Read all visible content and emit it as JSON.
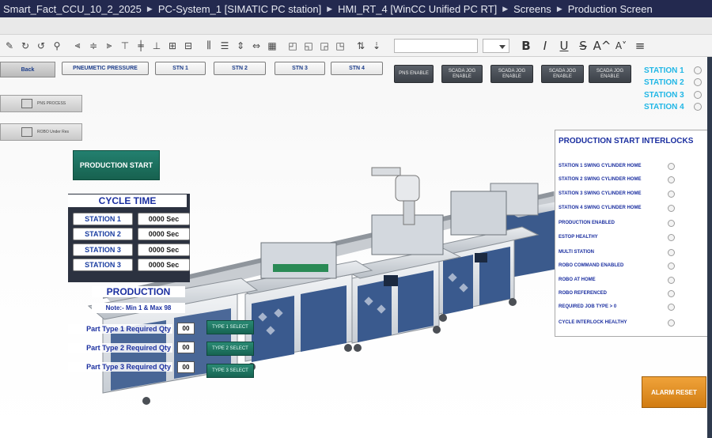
{
  "breadcrumb": [
    "Smart_Fact_CCU_10_2_2025",
    "PC-System_1 [SIMATIC PC station]",
    "HMI_RT_4 [WinCC Unified PC RT]",
    "Screens",
    "Production Screen"
  ],
  "toolbar": {
    "format_bold": "B",
    "format_italic": "I",
    "format_underline": "U",
    "format_strike": "S",
    "font_grow": "A^",
    "font_shrink": "A˅"
  },
  "nav": {
    "back": "Back",
    "top_buttons": [
      "PNEUMETIC PRESSURE",
      "STN 1",
      "STN 2",
      "STN 3",
      "STN 4"
    ],
    "dark_buttons": [
      "PNS ENABLE",
      "SCADA JOG ENABLE",
      "SCADA JOG ENABLE",
      "SCADA JOG ENABLE",
      "SCADA JOG ENABLE"
    ],
    "side_buttons": [
      "PNS PROCESS",
      "ROBO Under Res"
    ],
    "stations": [
      "STATION 1",
      "STATION 2",
      "STATION 3",
      "STATION 4"
    ]
  },
  "production_start": "PRODUCTION START",
  "cycle_time": {
    "title": "CYCLE TIME",
    "rows": [
      {
        "label": "STATION 1",
        "value": "0000 Sec"
      },
      {
        "label": "STATION 2",
        "value": "0000 Sec"
      },
      {
        "label": "STATION 3",
        "value": "0000 Sec"
      },
      {
        "label": "STATION 3",
        "value": "0000 Sec"
      }
    ]
  },
  "production": {
    "title": "PRODUCTION",
    "note": "Note:- Min 1 & Max 98",
    "parts": [
      {
        "label": "Part Type 1 Required Qty",
        "value": "00",
        "button": "TYPE 1 SELECT"
      },
      {
        "label": "Part Type 2 Required Qty",
        "value": "00",
        "button": "TYPE 2 SELECT"
      },
      {
        "label": "Part Type 3 Required Qty",
        "value": "00",
        "button": "TYPE 3 SELECT"
      }
    ]
  },
  "interlocks": {
    "title": "PRODUCTION START INTERLOCKS",
    "items": [
      "STATION 1 SWING CYLINDER HOME",
      "STATION 2 SWING CYLINDER HOME",
      "STATION 3 SWING CYLINDER  HOME",
      "STATION 4 SWING CYLINDER  HOME",
      "PRODUCTION ENABLED",
      "ESTOP HEALTHY",
      "MULTI STATION",
      "ROBO COMMAND ENABLED",
      "ROBO AT HOME",
      "ROBO REFERENCED",
      "REQUIRED JOB TYPE > 0",
      "CYCLE INTERLOCK HEALTHY"
    ]
  },
  "alarm_reset": "ALARM RESET",
  "colors": {
    "title_bg": "#23294f",
    "accent_teal": "#1c7463",
    "station_cyan": "#21b7e6",
    "label_blue": "#1b2fa0",
    "alarm_orange": "#e38e22"
  }
}
